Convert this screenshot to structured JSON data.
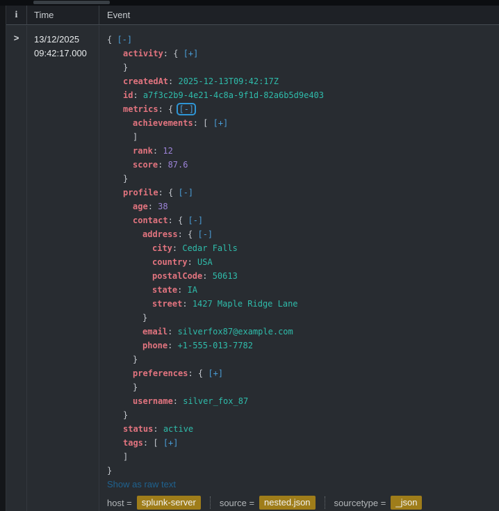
{
  "table": {
    "columns": {
      "info": "i",
      "time": "Time",
      "event": "Event"
    }
  },
  "event_row": {
    "expand_chevron": ">",
    "date": "13/12/2025",
    "time": "09:42:17.000"
  },
  "json": {
    "lines": [
      {
        "ind": 0,
        "seg": [
          {
            "t": "p",
            "v": "{ "
          },
          {
            "t": "tg",
            "v": "[-]"
          }
        ]
      },
      {
        "ind": 1,
        "seg": [
          {
            "t": "k",
            "v": "activity"
          },
          {
            "t": "p",
            "v": ": { "
          },
          {
            "t": "tg",
            "v": "[+]"
          }
        ]
      },
      {
        "ind": 1,
        "seg": [
          {
            "t": "p",
            "v": "}"
          }
        ]
      },
      {
        "ind": 1,
        "seg": [
          {
            "t": "k",
            "v": "createdAt"
          },
          {
            "t": "p",
            "v": ": "
          },
          {
            "t": "s",
            "v": "2025-12-13T09:42:17Z"
          }
        ]
      },
      {
        "ind": 1,
        "seg": [
          {
            "t": "k",
            "v": "id"
          },
          {
            "t": "p",
            "v": ": "
          },
          {
            "t": "s",
            "v": "a7f3c2b9-4e21-4c8a-9f1d-82a6b5d9e403"
          }
        ]
      },
      {
        "ind": 1,
        "seg": [
          {
            "t": "k",
            "v": "metrics"
          },
          {
            "t": "p",
            "v": ": { "
          },
          {
            "t": "tgf",
            "v": "[-]"
          }
        ]
      },
      {
        "ind": 2,
        "seg": [
          {
            "t": "k",
            "v": "achievements"
          },
          {
            "t": "p",
            "v": ": [ "
          },
          {
            "t": "tg",
            "v": "[+]"
          }
        ]
      },
      {
        "ind": 2,
        "seg": [
          {
            "t": "p",
            "v": "]"
          }
        ]
      },
      {
        "ind": 2,
        "seg": [
          {
            "t": "k",
            "v": "rank"
          },
          {
            "t": "p",
            "v": ": "
          },
          {
            "t": "n",
            "v": "12"
          }
        ]
      },
      {
        "ind": 2,
        "seg": [
          {
            "t": "k",
            "v": "score"
          },
          {
            "t": "p",
            "v": ": "
          },
          {
            "t": "n",
            "v": "87.6"
          }
        ]
      },
      {
        "ind": 1,
        "seg": [
          {
            "t": "p",
            "v": "}"
          }
        ]
      },
      {
        "ind": 1,
        "seg": [
          {
            "t": "k",
            "v": "profile"
          },
          {
            "t": "p",
            "v": ": { "
          },
          {
            "t": "tg",
            "v": "[-]"
          }
        ]
      },
      {
        "ind": 2,
        "seg": [
          {
            "t": "k",
            "v": "age"
          },
          {
            "t": "p",
            "v": ": "
          },
          {
            "t": "n",
            "v": "38"
          }
        ]
      },
      {
        "ind": 2,
        "seg": [
          {
            "t": "k",
            "v": "contact"
          },
          {
            "t": "p",
            "v": ": { "
          },
          {
            "t": "tg",
            "v": "[-]"
          }
        ]
      },
      {
        "ind": 3,
        "seg": [
          {
            "t": "k",
            "v": "address"
          },
          {
            "t": "p",
            "v": ": { "
          },
          {
            "t": "tg",
            "v": "[-]"
          }
        ]
      },
      {
        "ind": 4,
        "seg": [
          {
            "t": "k",
            "v": "city"
          },
          {
            "t": "p",
            "v": ": "
          },
          {
            "t": "s",
            "v": "Cedar Falls"
          }
        ]
      },
      {
        "ind": 4,
        "seg": [
          {
            "t": "k",
            "v": "country"
          },
          {
            "t": "p",
            "v": ": "
          },
          {
            "t": "s",
            "v": "USA"
          }
        ]
      },
      {
        "ind": 4,
        "seg": [
          {
            "t": "k",
            "v": "postalCode"
          },
          {
            "t": "p",
            "v": ": "
          },
          {
            "t": "s",
            "v": "50613"
          }
        ]
      },
      {
        "ind": 4,
        "seg": [
          {
            "t": "k",
            "v": "state"
          },
          {
            "t": "p",
            "v": ": "
          },
          {
            "t": "s",
            "v": "IA"
          }
        ]
      },
      {
        "ind": 4,
        "seg": [
          {
            "t": "k",
            "v": "street"
          },
          {
            "t": "p",
            "v": ": "
          },
          {
            "t": "s",
            "v": "1427 Maple Ridge Lane"
          }
        ]
      },
      {
        "ind": 3,
        "seg": [
          {
            "t": "p",
            "v": "}"
          }
        ]
      },
      {
        "ind": 3,
        "seg": [
          {
            "t": "k",
            "v": "email"
          },
          {
            "t": "p",
            "v": ": "
          },
          {
            "t": "s",
            "v": "silverfox87@example.com"
          }
        ]
      },
      {
        "ind": 3,
        "seg": [
          {
            "t": "k",
            "v": "phone"
          },
          {
            "t": "p",
            "v": ": "
          },
          {
            "t": "s",
            "v": "+1-555-013-7782"
          }
        ]
      },
      {
        "ind": 2,
        "seg": [
          {
            "t": "p",
            "v": "}"
          }
        ]
      },
      {
        "ind": 2,
        "seg": [
          {
            "t": "k",
            "v": "preferences"
          },
          {
            "t": "p",
            "v": ": { "
          },
          {
            "t": "tg",
            "v": "[+]"
          }
        ]
      },
      {
        "ind": 2,
        "seg": [
          {
            "t": "p",
            "v": "}"
          }
        ]
      },
      {
        "ind": 2,
        "seg": [
          {
            "t": "k",
            "v": "username"
          },
          {
            "t": "p",
            "v": ": "
          },
          {
            "t": "s",
            "v": "silver_fox_87"
          }
        ]
      },
      {
        "ind": 1,
        "seg": [
          {
            "t": "p",
            "v": "}"
          }
        ]
      },
      {
        "ind": 1,
        "seg": [
          {
            "t": "k",
            "v": "status"
          },
          {
            "t": "p",
            "v": ": "
          },
          {
            "t": "s",
            "v": "active"
          }
        ]
      },
      {
        "ind": 1,
        "seg": [
          {
            "t": "k",
            "v": "tags"
          },
          {
            "t": "p",
            "v": ": [ "
          },
          {
            "t": "tg",
            "v": "[+]"
          }
        ]
      },
      {
        "ind": 1,
        "seg": [
          {
            "t": "p",
            "v": "]"
          }
        ]
      },
      {
        "ind": 0,
        "seg": [
          {
            "t": "p",
            "v": "}"
          }
        ]
      }
    ]
  },
  "raw_text_link": "Show as raw text",
  "fields": [
    {
      "label": "host =",
      "value": "splunk-server"
    },
    {
      "label": "source =",
      "value": "nested.json"
    },
    {
      "label": "sourcetype =",
      "value": "_json"
    }
  ],
  "colors": {
    "key": "#e2747f",
    "string": "#2fbcab",
    "number": "#9d84d9",
    "punctuation": "#c6cad0",
    "toggle": "#4a9ed8",
    "toggle_focus_ring": "#2e96d6",
    "link": "#1f628f",
    "badge_bg": "#9f7d1a",
    "badge_text": "#f2f2ef",
    "header_bg": "#1e2126",
    "body_bg": "#282c31"
  }
}
